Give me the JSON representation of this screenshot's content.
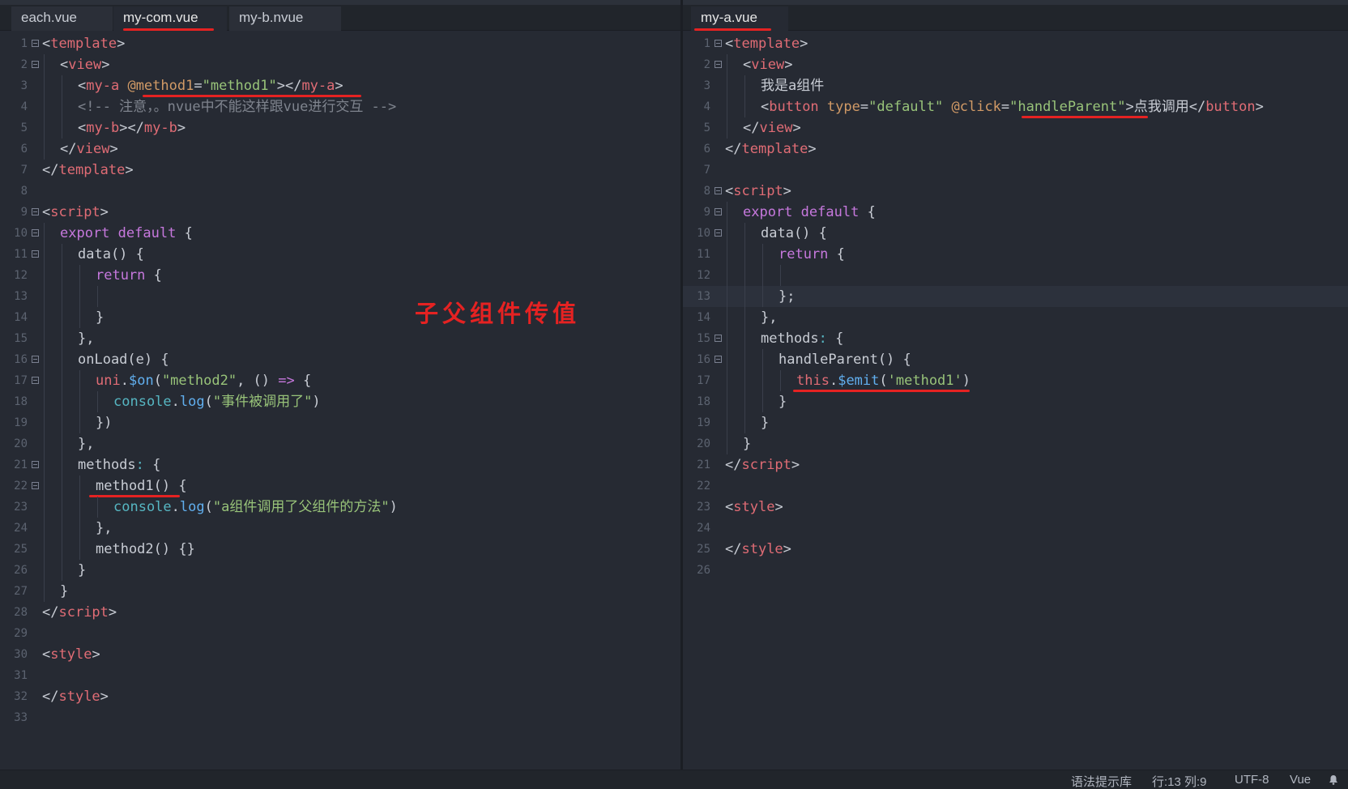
{
  "left_tabs": [
    {
      "label": "each.vue"
    },
    {
      "label": "my-com.vue"
    },
    {
      "label": "my-b.nvue"
    }
  ],
  "right_tabs": [
    {
      "label": "my-a.vue"
    }
  ],
  "annotation": "子父组件传值",
  "left_code": {
    "line_numbers": [
      "1",
      "2",
      "3",
      "4",
      "5",
      "6",
      "7",
      "8",
      "9",
      "10",
      "11",
      "12",
      "13",
      "14",
      "15",
      "16",
      "17",
      "18",
      "19",
      "20",
      "21",
      "22",
      "23",
      "24",
      "25",
      "26",
      "27",
      "28",
      "29",
      "30",
      "31",
      "32",
      "33"
    ],
    "l1": {
      "open": "<",
      "tag": "template",
      "close": ">"
    },
    "l2": {
      "open": "<",
      "tag": "view",
      "close": ">"
    },
    "l3": {
      "open": "<",
      "tag": "my-a",
      "attr": "@method1",
      "eq": "=",
      "val": "\"method1\"",
      "mid": "></",
      "tag2": "my-a",
      "close": ">"
    },
    "l4": {
      "comment": "<!-- 注意，。nvue中不能这样跟vue进行交互 -->"
    },
    "l5": {
      "open": "<",
      "tag": "my-b",
      "mid": "></",
      "tag2": "my-b",
      "close": ">"
    },
    "l6": {
      "open": "</",
      "tag": "view",
      "close": ">"
    },
    "l7": {
      "open": "</",
      "tag": "template",
      "close": ">"
    },
    "l9": {
      "open": "<",
      "tag": "script",
      "close": ">"
    },
    "l10": {
      "kw1": "export",
      "kw2": "default",
      "rest": "{"
    },
    "l11": {
      "text": "data() {"
    },
    "l12": {
      "kw": "return",
      "rest": "{"
    },
    "l14": {
      "text": "}"
    },
    "l15": {
      "text": "},"
    },
    "l16": {
      "text": "onLoad(e) {"
    },
    "l17": {
      "obj": "uni",
      "dot": ".",
      "fn": "$on",
      "p1": "(",
      "str": "\"method2\"",
      "p2": ", () ",
      "arrow": "=>",
      "p3": " {"
    },
    "l18": {
      "obj": "console",
      "dot": ".",
      "fn": "log",
      "p1": "(",
      "str": "\"事件被调用了\"",
      "p2": ")"
    },
    "l19": {
      "text": "})"
    },
    "l20": {
      "text": "},"
    },
    "l21": {
      "text": "methods",
      "colon": ":",
      "rest": " {"
    },
    "l22": {
      "text": "method1() {"
    },
    "l23": {
      "obj": "console",
      "dot": ".",
      "fn": "log",
      "p1": "(",
      "str": "\"a组件调用了父组件的方法\"",
      "p2": ")"
    },
    "l24": {
      "text": "},"
    },
    "l25": {
      "text": "method2() {}"
    },
    "l26": {
      "text": "}"
    },
    "l27": {
      "text": "}"
    },
    "l28": {
      "open": "</",
      "tag": "script",
      "close": ">"
    },
    "l30": {
      "open": "<",
      "tag": "style",
      "close": ">"
    },
    "l32": {
      "open": "</",
      "tag": "style",
      "close": ">"
    }
  },
  "right_code": {
    "line_numbers": [
      "1",
      "2",
      "3",
      "4",
      "5",
      "6",
      "7",
      "8",
      "9",
      "10",
      "11",
      "12",
      "13",
      "14",
      "15",
      "16",
      "17",
      "18",
      "19",
      "20",
      "21",
      "22",
      "23",
      "24",
      "25",
      "26"
    ],
    "l1": {
      "open": "<",
      "tag": "template",
      "close": ">"
    },
    "l2": {
      "open": "<",
      "tag": "view",
      "close": ">"
    },
    "l3": {
      "text": "我是a组件"
    },
    "l4": {
      "open": "<",
      "tag": "button",
      "attr1": "type",
      "eq1": "=",
      "val1": "\"default\"",
      "attr2": "@click",
      "eq2": "=",
      "val2": "\"handleParent\"",
      "text": ">点我调用</",
      "tag2": "button",
      "close": ">"
    },
    "l5": {
      "open": "</",
      "tag": "view",
      "close": ">"
    },
    "l6": {
      "open": "</",
      "tag": "template",
      "close": ">"
    },
    "l8": {
      "open": "<",
      "tag": "script",
      "close": ">"
    },
    "l9": {
      "kw1": "export",
      "kw2": "default",
      "rest": "{"
    },
    "l10": {
      "text": "data() {"
    },
    "l11": {
      "kw": "return",
      "rest": "{"
    },
    "l13": {
      "text": "};"
    },
    "l14": {
      "text": "},"
    },
    "l15": {
      "text": "methods",
      "colon": ":",
      "rest": " {"
    },
    "l16": {
      "text": "handleParent() {"
    },
    "l17": {
      "this": "this",
      "dot": ".",
      "fn": "$emit",
      "p1": "(",
      "str": "'method1'",
      "p2": ")"
    },
    "l18": {
      "text": "}"
    },
    "l19": {
      "text": "}"
    },
    "l20": {
      "text": "}"
    },
    "l21": {
      "open": "</",
      "tag": "script",
      "close": ">"
    },
    "l23": {
      "open": "<",
      "tag": "style",
      "close": ">"
    },
    "l25": {
      "open": "</",
      "tag": "style",
      "close": ">"
    }
  },
  "status": {
    "syntax_lib": "语法提示库",
    "position": "行:13  列:9",
    "encoding": "UTF-8",
    "language": "Vue"
  },
  "colors": {
    "annotation_red": "#e52222",
    "background": "#262a33",
    "tag": "#e06c75",
    "string": "#98c379",
    "keyword": "#c678dd",
    "function": "#61afef",
    "attribute": "#d19a66"
  }
}
